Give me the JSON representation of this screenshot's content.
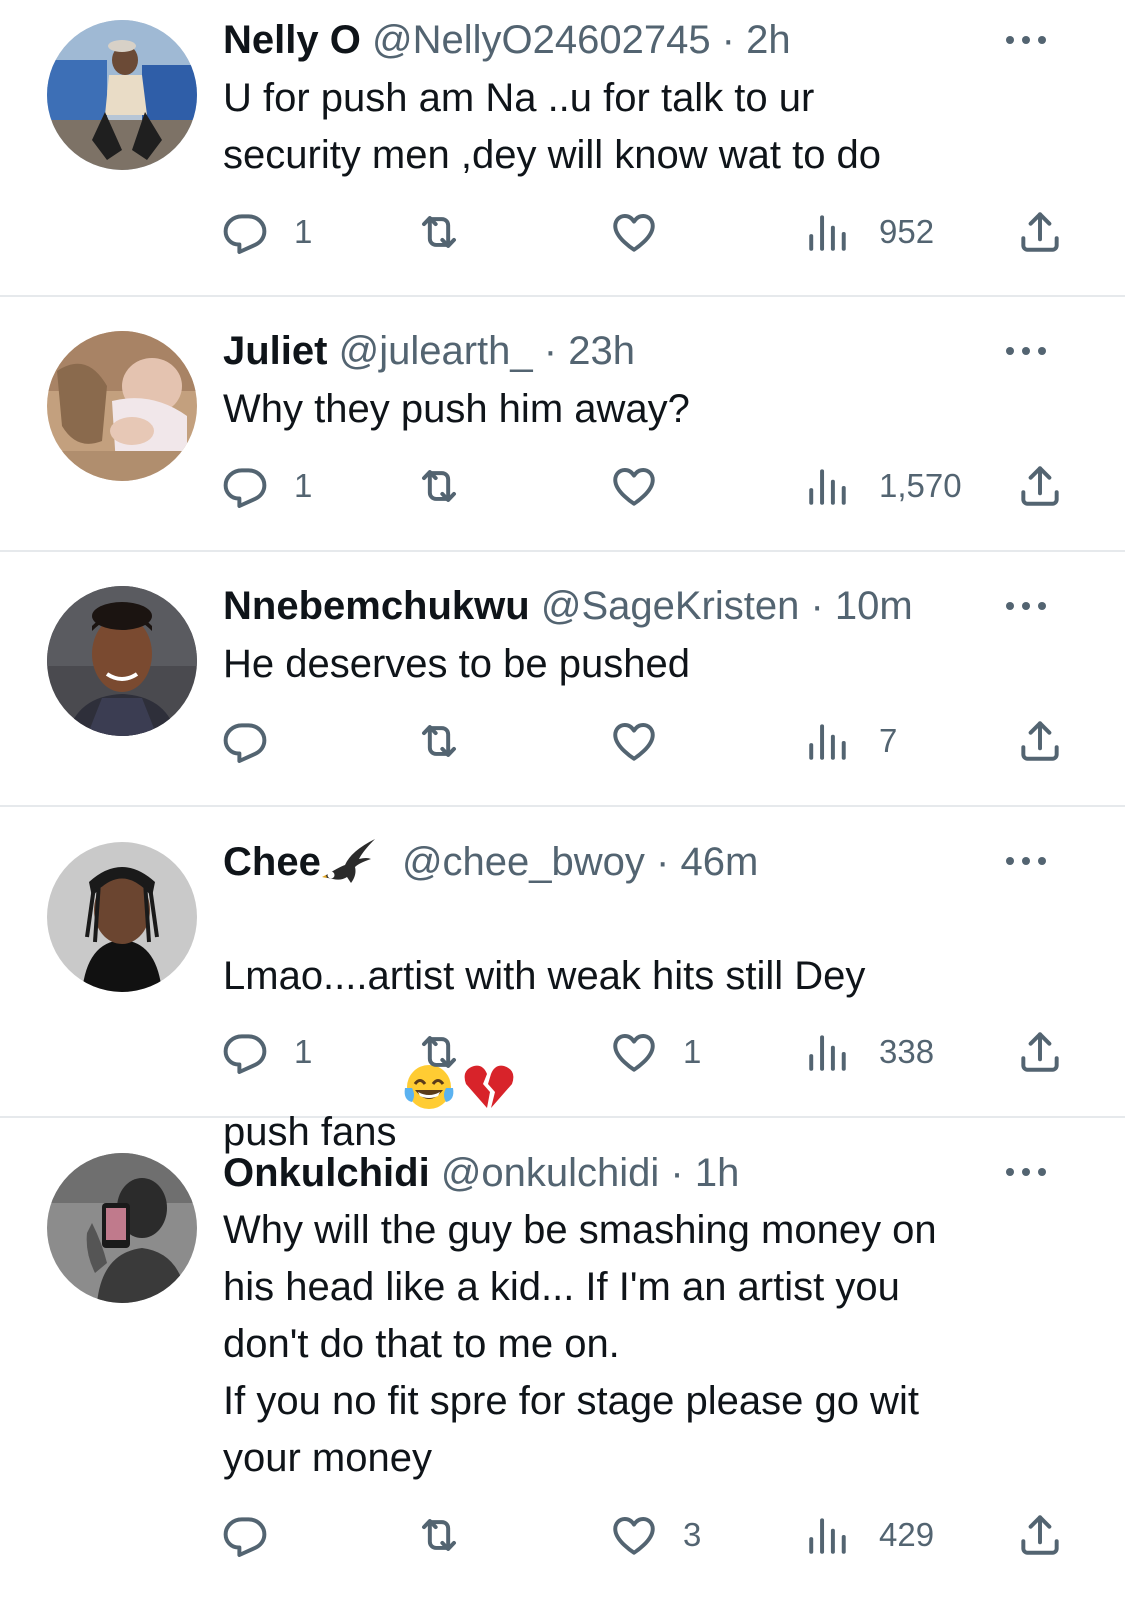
{
  "colors": {
    "text_primary": "#0f1419",
    "text_secondary": "#536471",
    "divider": "#e6e9ec"
  },
  "tweets": [
    {
      "name": "Nelly O",
      "handle": "@NellyO24602745",
      "separator": "·",
      "time": "2h",
      "text": "U for push am Na ..u for talk to ur\nsecurity men ,dey will know wat to do",
      "replies": "1",
      "retweets": "",
      "likes": "",
      "views": "952"
    },
    {
      "name": "Juliet",
      "handle": "@julearth_",
      "separator": "·",
      "time": "23h",
      "text": "Why they push him away?",
      "replies": "1",
      "retweets": "",
      "likes": "",
      "views": "1,570"
    },
    {
      "name": "Nnebemchukwu",
      "handle": "@SageKristen",
      "separator": "·",
      "time": "10m",
      "text": "He deserves to be pushed",
      "replies": "",
      "retweets": "",
      "likes": "",
      "views": "7"
    },
    {
      "name": "Chee",
      "name_emoji": "eagle-icon",
      "handle": "@chee_bwoy",
      "separator": "·",
      "time": "46m",
      "text": "Lmao....artist with weak hits still Dey\npush fans",
      "text_emojis": [
        "face-with-tears-of-joy",
        "broken-heart"
      ],
      "replies": "1",
      "retweets": "",
      "likes": "1",
      "views": "338"
    },
    {
      "name": "Onkulchidi",
      "handle": "@onkulchidi",
      "separator": "·",
      "time": "1h",
      "text": "Why will the guy be smashing money on\nhis head like a kid... If I'm an artist you\ndon't do that to me on.\nIf you no fit spre for stage please go wit\nyour money",
      "replies": "",
      "retweets": "",
      "likes": "3",
      "views": "429"
    }
  ]
}
